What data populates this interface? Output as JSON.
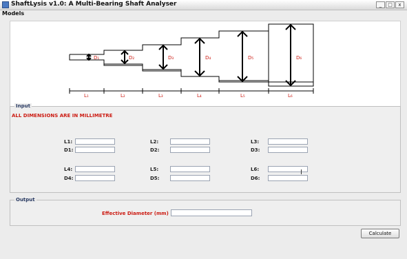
{
  "window": {
    "title": "ShaftLysis v1.0: A Multi-Bearing Shaft Analyser",
    "minimize": "_",
    "maximize": "□",
    "close": "x"
  },
  "menu": {
    "models": "Models"
  },
  "diagram": {
    "diameters": [
      "D1",
      "D2",
      "D3",
      "D4",
      "D5",
      "D6"
    ],
    "lengths": [
      "L1",
      "L2",
      "L3",
      "L4",
      "L5",
      "L6"
    ],
    "accent": "#cc1b12"
  },
  "input": {
    "title": "Input",
    "notice": "ALL DIMENSIONS ARE IN MILLIMETRE",
    "labels": {
      "L1": "L1:",
      "D1": "D1:",
      "L2": "L2:",
      "D2": "D2:",
      "L3": "L3:",
      "D3": "D3:",
      "L4": "L4:",
      "D4": "D4:",
      "L5": "L5:",
      "D5": "D5:",
      "L6": "L6:",
      "D6": "D6:"
    }
  },
  "output": {
    "title": "Output",
    "effective_label": "Effective Diameter (mm) :"
  },
  "actions": {
    "calculate": "Calculate"
  }
}
